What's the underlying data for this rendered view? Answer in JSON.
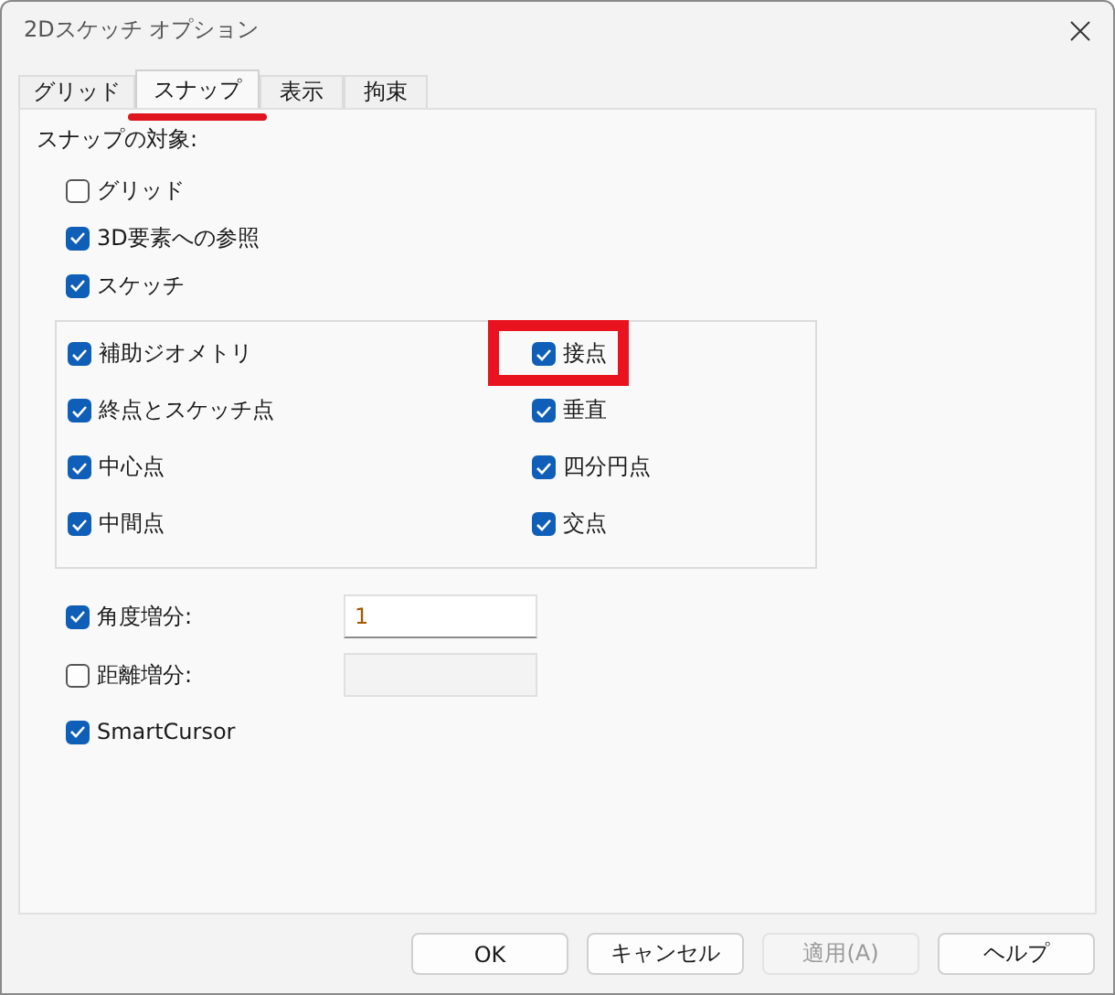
{
  "window": {
    "title": "2Dスケッチ オプション"
  },
  "tabs": [
    {
      "label": "グリッド",
      "selected": false,
      "highlighted": false
    },
    {
      "label": "スナップ",
      "selected": true,
      "highlighted": true
    },
    {
      "label": "表示",
      "selected": false,
      "highlighted": false
    },
    {
      "label": "拘束",
      "selected": false,
      "highlighted": false
    }
  ],
  "section_label": "スナップの対象:",
  "options": [
    {
      "label": "グリッド",
      "checked": false
    },
    {
      "label": "3D要素への参照",
      "checked": true
    },
    {
      "label": "スケッチ",
      "checked": true
    }
  ],
  "group": [
    {
      "label": "補助ジオメトリ",
      "checked": true,
      "highlighted": false
    },
    {
      "label": "接点",
      "checked": true,
      "highlighted": true
    },
    {
      "label": "終点とスケッチ点",
      "checked": true,
      "highlighted": false
    },
    {
      "label": "垂直",
      "checked": true,
      "highlighted": false
    },
    {
      "label": "中心点",
      "checked": true,
      "highlighted": false
    },
    {
      "label": "四分円点",
      "checked": true,
      "highlighted": false
    },
    {
      "label": "中間点",
      "checked": true,
      "highlighted": false
    },
    {
      "label": "交点",
      "checked": true,
      "highlighted": false
    }
  ],
  "increments": [
    {
      "label": "角度増分:",
      "checked": true,
      "value": "1",
      "disabled": false
    },
    {
      "label": "距離増分:",
      "checked": false,
      "disabled": true
    }
  ],
  "smart_cursor": {
    "label": "SmartCursor",
    "checked": true
  },
  "buttons": [
    {
      "label": "OK",
      "disabled": false
    },
    {
      "label": "キャンセル",
      "disabled": false
    },
    {
      "label": "適用(A)",
      "disabled": true
    },
    {
      "label": "ヘルプ",
      "disabled": false
    }
  ]
}
